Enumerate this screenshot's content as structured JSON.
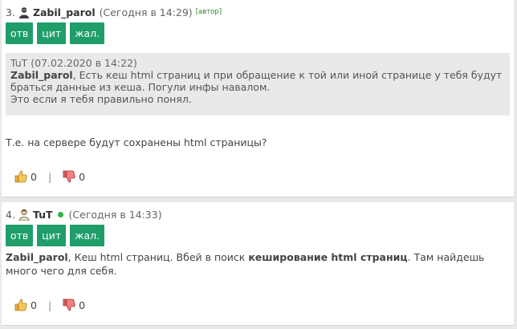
{
  "posts": [
    {
      "number": "3.",
      "author": "Zabil_parol",
      "time": "(Сегодня в 14:29)",
      "author_tag": "[автор]",
      "buttons": {
        "reply": "отв",
        "quote": "цит",
        "complain": "жал."
      },
      "quote": {
        "header": "TuT (07.02.2020 в 14:22)",
        "author": "Zabil_parol",
        "text_part1": ", Есть кеш html страниц и при обращение к той или иной странице у тебя будут",
        "text_part2": "браться данные из кеша. Погули инфы навалом.",
        "text_part3": "Это если я тебя правильно понял."
      },
      "body": "Т.е. на сервере будут сохранены html страницы?",
      "likes": "0",
      "separator": "|",
      "dislikes": "0"
    },
    {
      "number": "4.",
      "author": "TuT",
      "online": true,
      "time": "(Сегодня в 14:33)",
      "buttons": {
        "reply": "отв",
        "quote": "цит",
        "complain": "жал."
      },
      "body_author": "Zabil_parol",
      "body_part1": ", Кеш html страниц. Вбей в поиск ",
      "body_bold": "кеширование html страниц",
      "body_part2": ". Там найдешь",
      "body_part3": "много чего для себя.",
      "likes": "0",
      "separator": "|",
      "dislikes": "0"
    }
  ],
  "colors": {
    "button": "#1f9e6a",
    "online": "#2bb34b",
    "quote_bg": "#e9e9e9",
    "author_tag": "#2a8a2a"
  },
  "icons": {
    "user": "user-avatar-icon",
    "like": "thumbs-up-icon",
    "dislike": "thumbs-down-icon"
  }
}
